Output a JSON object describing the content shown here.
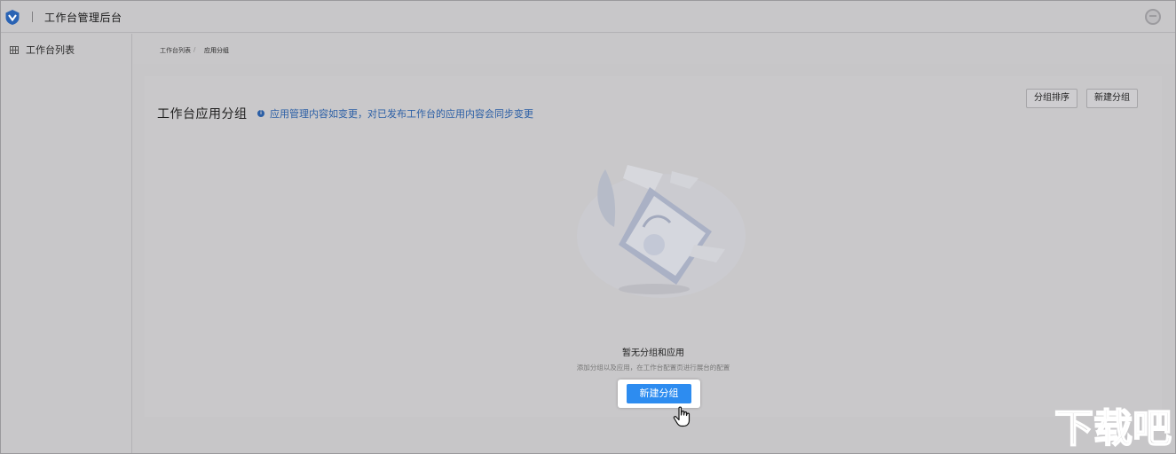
{
  "header": {
    "title": "工作台管理后台",
    "logo_icon": "shield-logo-icon",
    "avatar_icon": "user-avatar-icon"
  },
  "sidebar": {
    "items": [
      {
        "label": "工作台列表",
        "icon": "grid-icon"
      }
    ]
  },
  "breadcrumb": {
    "items": [
      "工作台列表",
      "应用分组"
    ],
    "separator": "/"
  },
  "main": {
    "title": "工作台应用分组",
    "notice": "应用管理内容如变更，对已发布工作台的应用内容会同步变更",
    "buttons": {
      "sort": "分组排序",
      "new_group": "新建分组"
    },
    "empty_state": {
      "title": "暂无分组和应用",
      "description": "添加分组以及应用，在工作台配置页进行展台的配置",
      "button": "新建分组"
    }
  },
  "watermark": {
    "text": "下载吧"
  },
  "colors": {
    "primary": "#2d8cf0",
    "notice": "#2b5fa6",
    "overlay_bg": "#c7c6c8"
  }
}
